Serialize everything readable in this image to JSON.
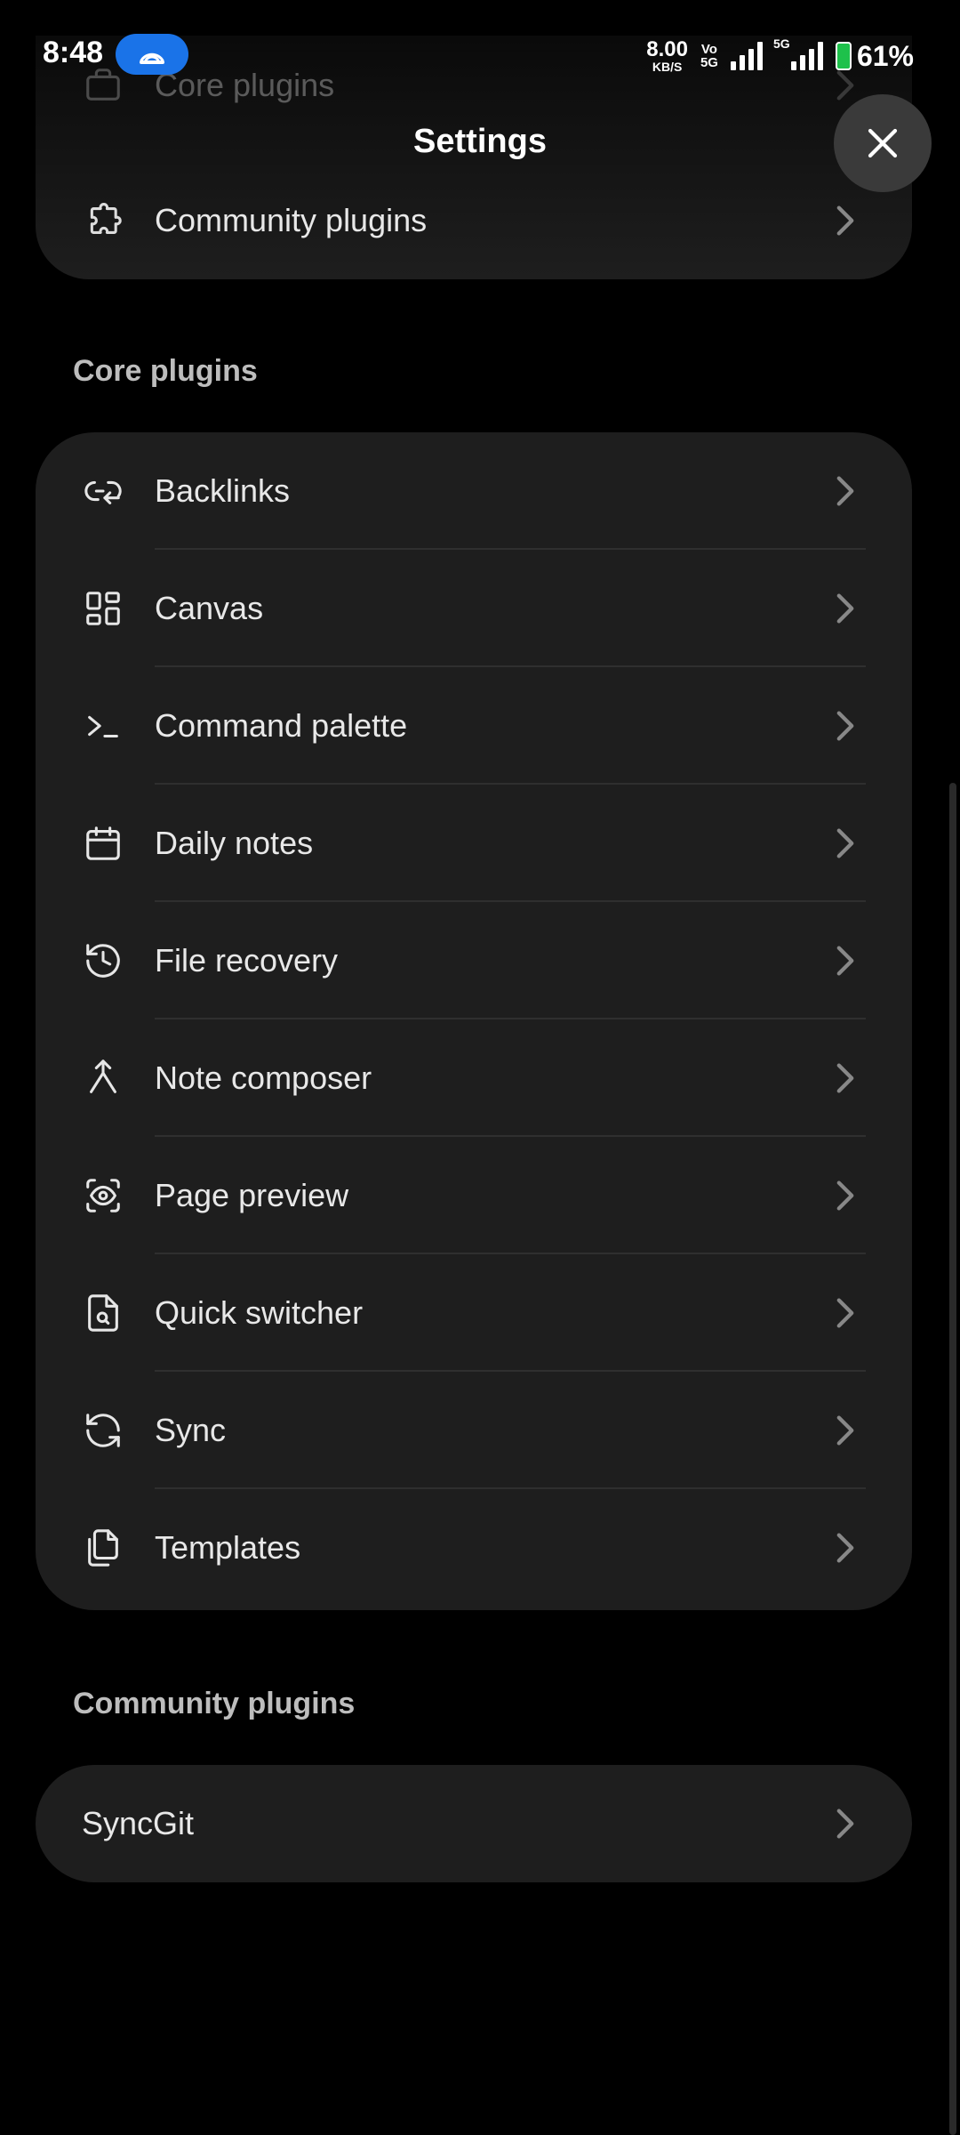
{
  "status_bar": {
    "time": "8:48",
    "net_speed_value": "8.00",
    "net_speed_unit": "KB/S",
    "volte_top": "Vo",
    "volte_bottom": "5G",
    "five_g_tag": "5G",
    "battery_percent": "61%"
  },
  "header": {
    "title": "Settings",
    "close_icon": "close-icon"
  },
  "top_card": {
    "items": [
      {
        "label": "Core plugins",
        "icon": "briefcase-icon"
      },
      {
        "label": "Community plugins",
        "icon": "puzzle-icon"
      }
    ]
  },
  "core_plugins": {
    "title": "Core plugins",
    "items": [
      {
        "label": "Backlinks",
        "icon": "backlink-icon"
      },
      {
        "label": "Canvas",
        "icon": "layout-dashboard-icon"
      },
      {
        "label": "Command palette",
        "icon": "terminal-icon"
      },
      {
        "label": "Daily notes",
        "icon": "calendar-icon"
      },
      {
        "label": "File recovery",
        "icon": "history-icon"
      },
      {
        "label": "Note composer",
        "icon": "merge-icon"
      },
      {
        "label": "Page preview",
        "icon": "scan-eye-icon"
      },
      {
        "label": "Quick switcher",
        "icon": "file-search-icon"
      },
      {
        "label": "Sync",
        "icon": "sync-icon"
      },
      {
        "label": "Templates",
        "icon": "files-icon"
      }
    ]
  },
  "community_plugins": {
    "title": "Community plugins",
    "items": [
      {
        "label": "SyncGit"
      }
    ]
  },
  "colors": {
    "background": "#000000",
    "card": "#1e1e1e",
    "text": "#e8e8e8",
    "section_title": "#bdbdbd",
    "hotspot_pill": "#1a73e8",
    "battery_fill": "#1ec14b"
  }
}
